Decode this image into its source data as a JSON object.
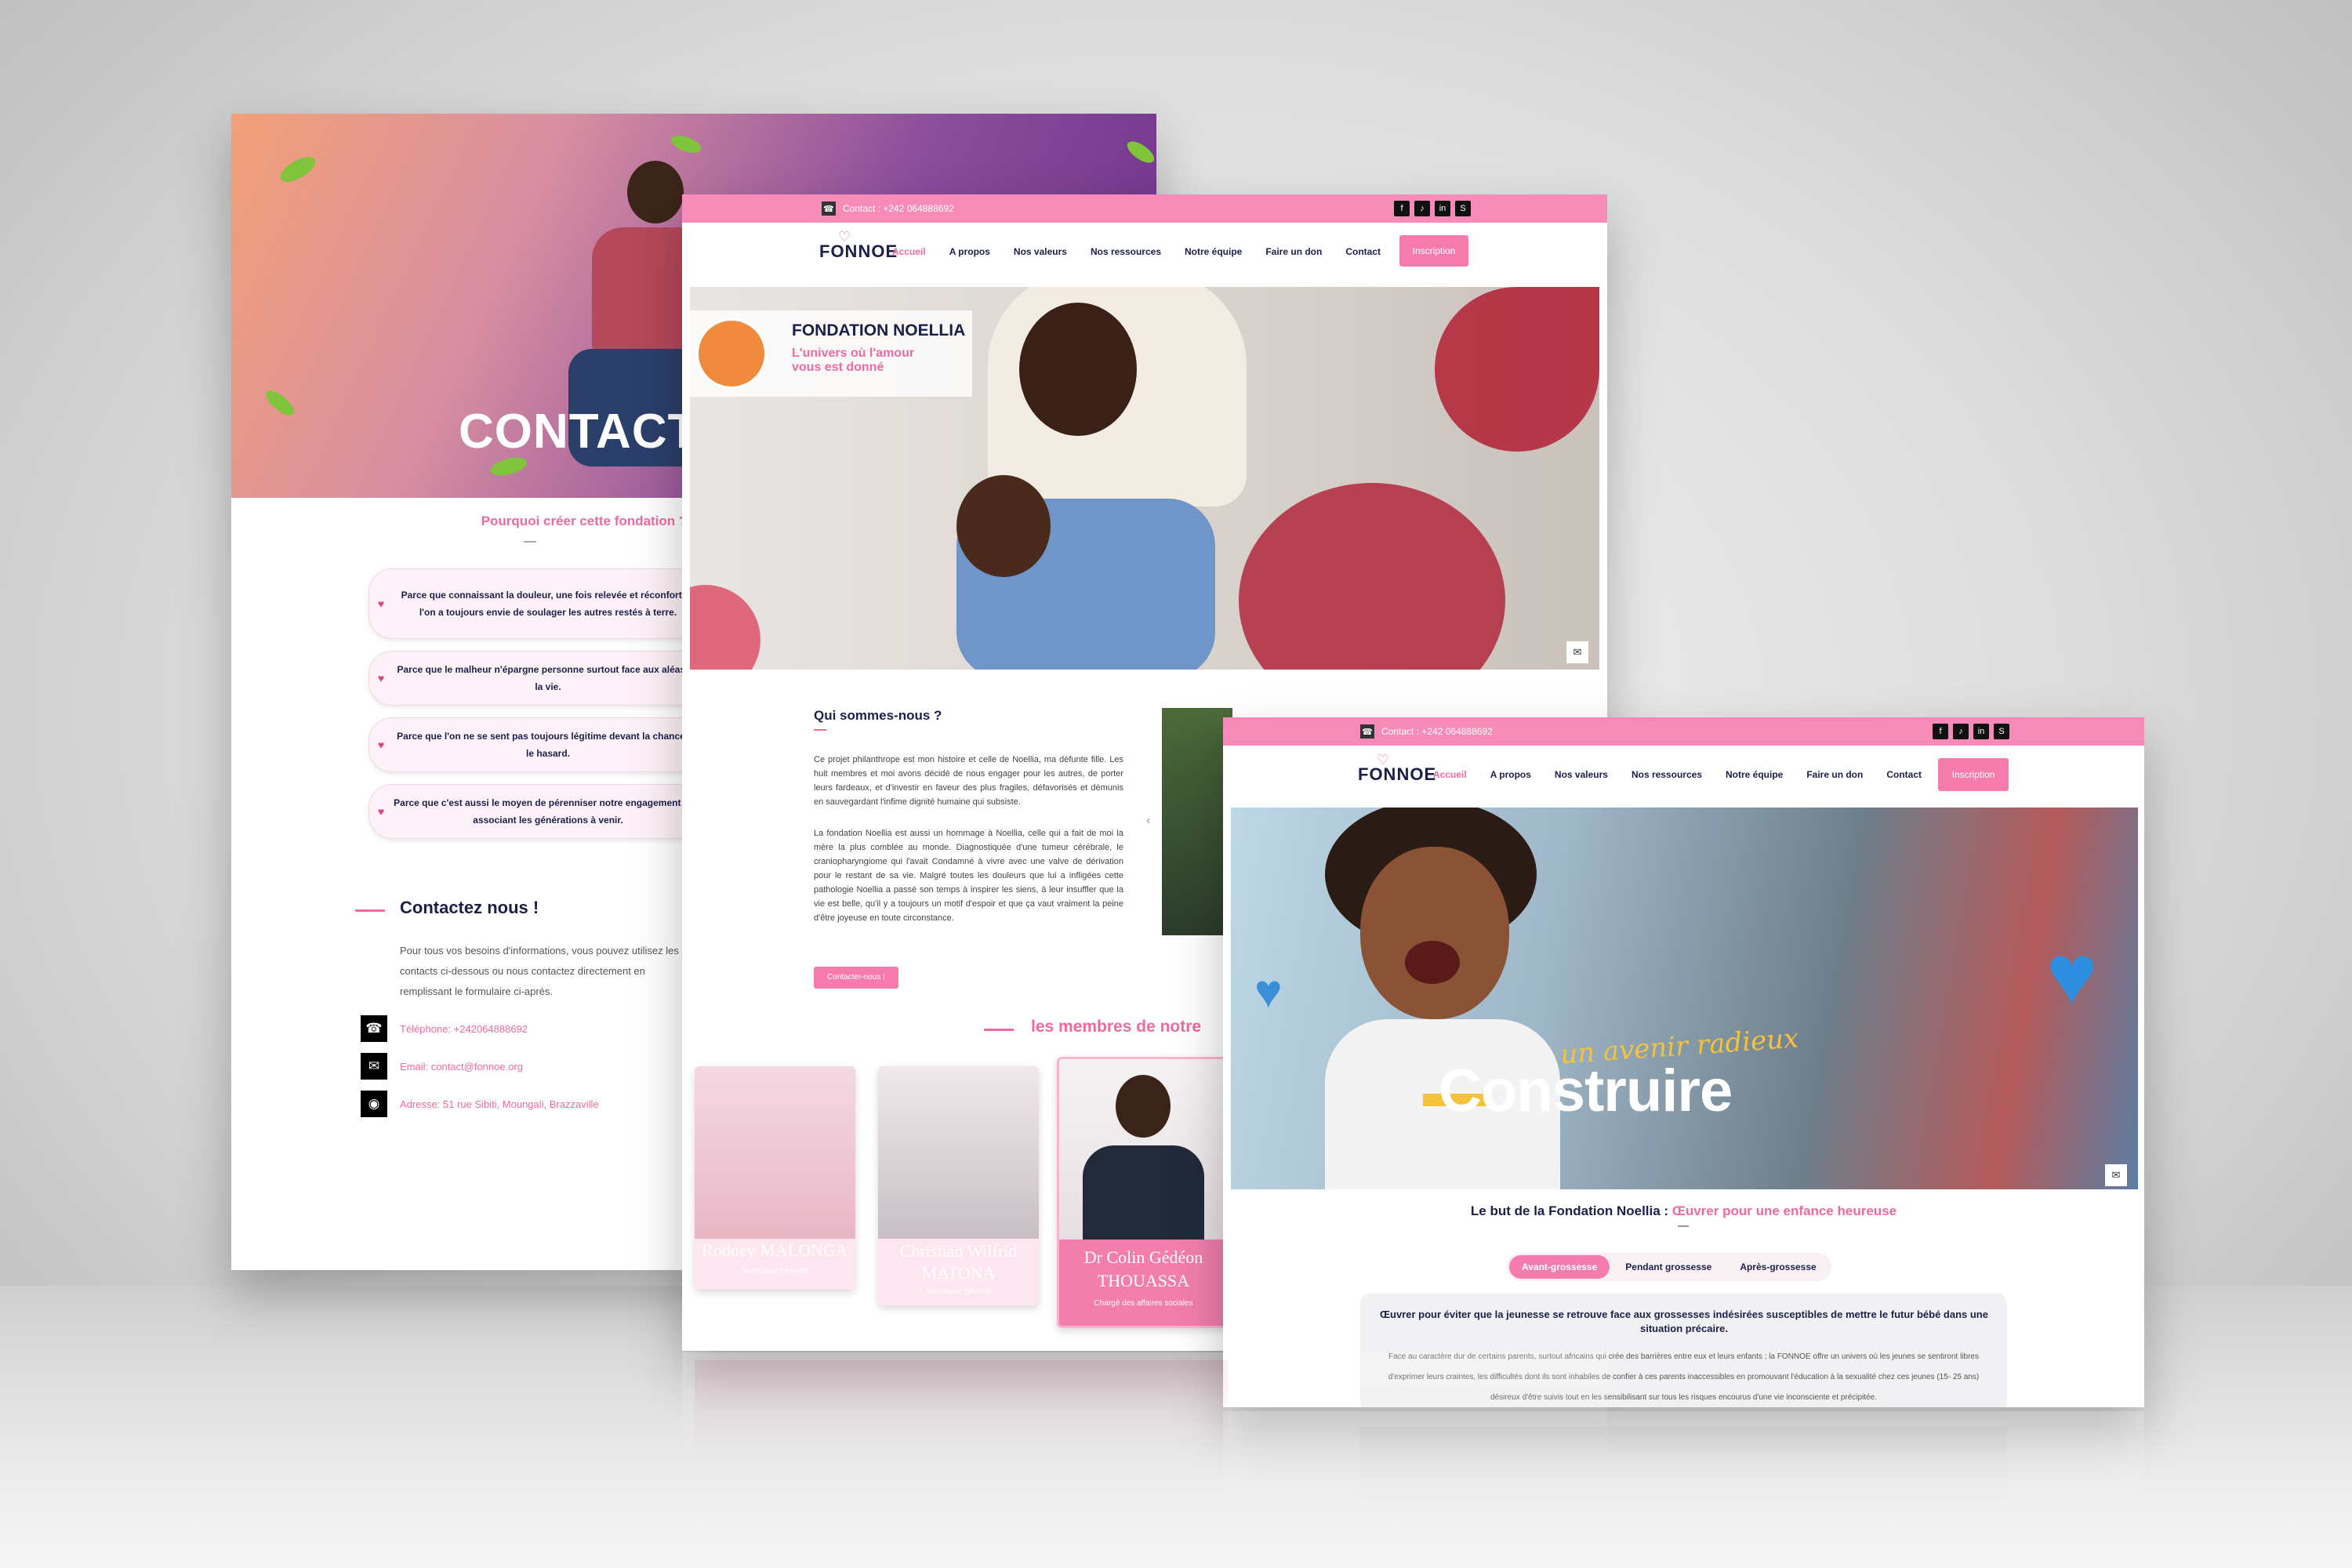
{
  "mock1": {
    "hero_title": "CONTACTEZ",
    "why_title": "Pourquoi créer cette fondation ?",
    "reasons": [
      "Parce que connaissant la douleur, une fois relevée et réconfortée, l'on a toujours envie de soulager les autres restés à terre.",
      "Parce que le malheur n'épargne personne surtout face aux aléas de la vie.",
      "Parce que l'on ne se sent pas toujours légitime devant la chance ou le hasard.",
      "Parce que c'est aussi le moyen de pérenniser notre engagement en y associant les générations à venir."
    ],
    "contact_title": "Contactez nous !",
    "contact_text": "Pour tous vos besoins d'informations, vous pouvez utilisez les contacts ci-dessous ou nous contactez directement en remplissant le formulaire ci-après.",
    "phone": "Téléphone: +242064888692",
    "email": "Email: contact@fonnoe.org",
    "address": "Adresse: 51 rue Sibiti, Moungali, Brazzaville"
  },
  "mock2": {
    "contact_bar": "Contact : +242 064888692",
    "logo": "FONNOE",
    "nav": [
      "Accueil",
      "A propos",
      "Nos valeurs",
      "Nos ressources",
      "Notre équipe",
      "Faire un don",
      "Contact"
    ],
    "inscription": "Inscription",
    "banner_title": "FONDATION NOELLIA",
    "banner_sub": "L'univers où l'amour vous est donné",
    "who_title": "Qui sommes-nous ?",
    "who_p1": "Ce projet philanthrope est mon histoire et celle de Noellia, ma défunte fille. Les huit membres et moi avons décidé de nous engager pour les autres, de porter leurs fardeaux, et d'investir en faveur des plus fragiles, défavorisés et démunis en sauvegardant l'infime dignité humaine qui subsiste.",
    "who_p2": "La fondation Noellia est aussi un hommage à Noellia, celle qui a fait de moi la mère la plus comblée au monde. Diagnostiquée d'une tumeur cérébrale, le craniopharyngiome qui l'avait Condamné à vivre avec une valve de dérivation pour le restant de sa vie. Malgré toutes les douleurs que lui a infligées cette pathologie Noellia a passé son temps à inspirer les siens, à leur insuffler que la vie est belle, qu'il y a toujours un motif d'espoir et que ça vaut vraiment la peine d'être joyeuse en toute circonstance.",
    "contact_btn": "Contacter-nous !",
    "members_title": "les membres de notre",
    "members": [
      {
        "name": "Rodney MALONGA",
        "role": "Secrétaire trésorier"
      },
      {
        "name": "Christian Wilfrid MATONA",
        "role": "Secrétaire général"
      },
      {
        "name": "Dr Colin Gédéon THOUASSA",
        "role": "Chargé des affaires sociales"
      }
    ]
  },
  "mock3": {
    "contact_bar": "Contact : +242 064888692",
    "logo": "FONNOE",
    "nav": [
      "Accueil",
      "A propos",
      "Nos valeurs",
      "Nos ressources",
      "Notre équipe",
      "Faire un don",
      "Contact"
    ],
    "inscription": "Inscription",
    "hero_script": "un avenir radieux",
    "hero_word": "Construire",
    "goal_prefix": "Le but de la Fondation Noellia :",
    "goal_highlight": "Œuvrer pour une enfance heureuse",
    "tabs": [
      "Avant-grossesse",
      "Pendant grossesse",
      "Après-grossesse"
    ],
    "box_title": "Œuvrer pour éviter que la jeunesse se retrouve face aux grossesses indésirées susceptibles de mettre le futur bébé dans une situation précaire.",
    "box_text": "Face au caractère dur de certains parents, surtout africains qui crée des barrières entre eux et leurs enfants ; la FONNOE offre un univers où les jeunes se sentiront libres d'exprimer leurs craintes, les difficultés dont ils sont inhabiles de confier à ces parents inaccessibles en promouvant l'éducation à la sexualité chez ces jeunes (15- 25 ans) désireux d'être suivis tout en les sensibilisant sur tous les risques encourus d'une vie inconsciente et précipitée."
  },
  "colors": {
    "accent": "#f06aa0",
    "navy": "#1c1f4a",
    "bar": "#f78bb8"
  }
}
